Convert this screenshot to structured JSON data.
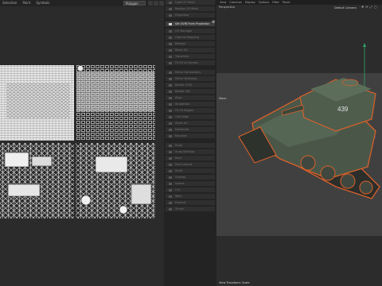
{
  "uv_editor": {
    "menus": [
      "Selection",
      "Paint",
      "Symbols"
    ],
    "selection_mode": "Polygon"
  },
  "middle_panel": {
    "items": [
      {
        "label": "Load UV Mesh"
      },
      {
        "label": "Realign UV Mesh"
      },
      {
        "label": "Projection"
      },
      {
        "label": "Set UVW From Projection",
        "highlighted": true
      },
      {
        "label": "UV Manager"
      },
      {
        "label": "Optimal Mapping"
      },
      {
        "label": "Realign"
      },
      {
        "label": "Relax UV"
      },
      {
        "label": "Transform"
      },
      {
        "label": "Fit UV to Canvas"
      },
      {
        "label": "Mirror Horizontally"
      },
      {
        "label": "Mirror Vertically"
      },
      {
        "label": "Rotate CCW"
      },
      {
        "label": "Rotate CW"
      },
      {
        "label": "Align"
      },
      {
        "label": "Straighten"
      },
      {
        "label": "Fit UV Region"
      },
      {
        "label": "Grid Align"
      },
      {
        "label": "Stack UV"
      },
      {
        "label": "Distribute"
      },
      {
        "label": "Equalize"
      },
      {
        "label": "Snap"
      },
      {
        "label": "Snap Settings"
      },
      {
        "label": "Pack"
      },
      {
        "label": "Pack Islands"
      },
      {
        "label": "Shelf"
      },
      {
        "label": "Unwrap"
      },
      {
        "label": "Seams"
      },
      {
        "label": "Cut"
      },
      {
        "label": "Weld"
      },
      {
        "label": "Expand"
      },
      {
        "label": "Shrink"
      }
    ]
  },
  "viewport": {
    "menus": [
      "View",
      "Cameras",
      "Display",
      "Options",
      "Filter",
      "Panel"
    ],
    "label": "Perspective",
    "camera": "Default Camera",
    "move_label": "Move",
    "status": "View Transform: Scale",
    "colors": {
      "tank_body": "#4a5748",
      "tank_dark": "#333b33",
      "selection_outline": "#d9612b"
    }
  }
}
